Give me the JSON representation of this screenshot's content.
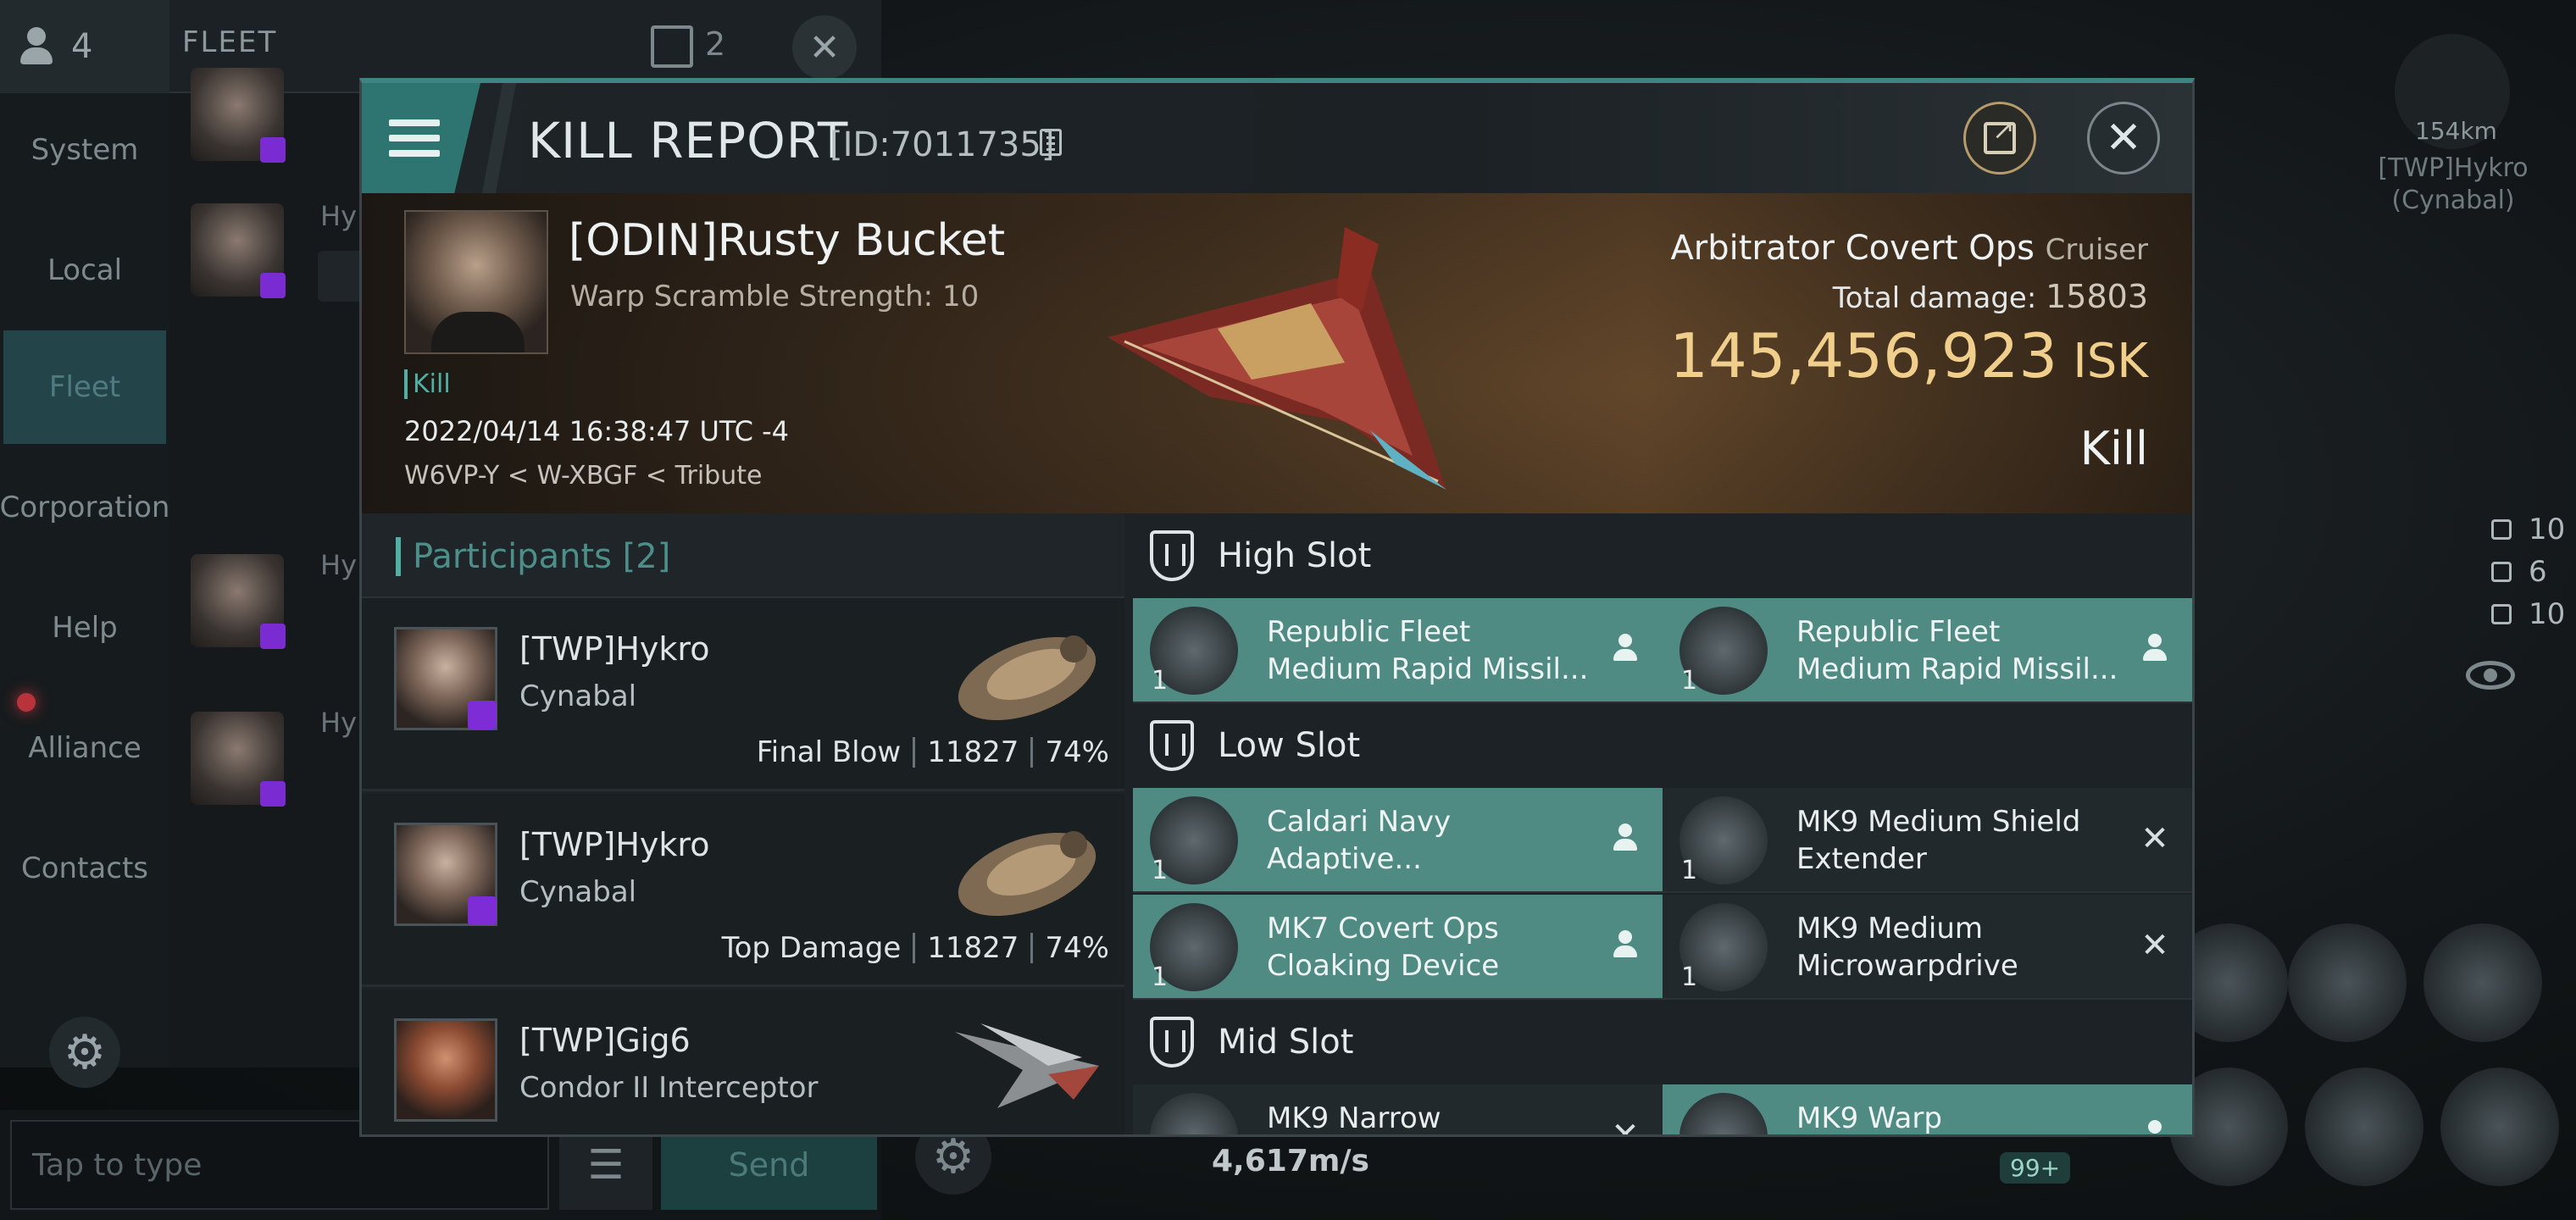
{
  "background": {
    "member_count": "4",
    "fleet_label": "FLEET",
    "fleet_window_count": "2",
    "nav": [
      "System",
      "Local",
      "Fleet",
      "Corporation",
      "Help",
      "Alliance",
      "Contacts"
    ],
    "chat_name_prefix": "Hy",
    "chat_input_placeholder": "Tap to type",
    "send_label": "Send",
    "speed": "4,617m/s",
    "target": {
      "distance": "154km",
      "name": "[TWP]Hykro (Cynabal)"
    },
    "stats": [
      "10",
      "6",
      "10"
    ],
    "cargo_badge": "99+"
  },
  "modal": {
    "title": "KILL REPORT",
    "report_id": "[ID:7011735]",
    "victim": {
      "name": "[ODIN]Rusty Bucket",
      "warp_scramble": "Warp Scramble Strength: 10",
      "kill_tag": "Kill",
      "date": "2022/04/14 16:38:47 UTC -4",
      "location": "W6VP-Y < W-XBGF < Tribute",
      "ship": "Arbitrator Covert Ops",
      "ship_class": "Cruiser",
      "total_damage_label": "Total damage:",
      "total_damage": "15803",
      "isk_value": "145,456,923",
      "isk_unit": "ISK",
      "result": "Kill"
    },
    "participants": {
      "header": "Participants [2]",
      "rows": [
        {
          "name": "[TWP]Hykro",
          "ship": "Cynabal",
          "role": "Final Blow",
          "damage": "11827",
          "percent": "74%"
        },
        {
          "name": "[TWP]Hykro",
          "ship": "Cynabal",
          "role": "Top Damage",
          "damage": "11827",
          "percent": "74%"
        },
        {
          "name": "[TWP]Gig6",
          "ship": "Condor II Interceptor"
        }
      ]
    },
    "fitting": {
      "high_slot": "High Slot",
      "low_slot": "Low Slot",
      "mid_slot": "Mid Slot",
      "modules": {
        "high_1": {
          "name": "Republic Fleet Medium Rapid Missil...",
          "qty": "1"
        },
        "high_2": {
          "name": "Republic Fleet Medium Rapid Missil...",
          "qty": "1"
        },
        "low_1": {
          "name": "Caldari Navy Adaptive...",
          "qty": "1"
        },
        "low_2": {
          "name": "MK9 Medium Shield Extender",
          "qty": "1"
        },
        "low_3": {
          "name": "MK7 Covert Ops Cloaking Device",
          "qty": "1"
        },
        "low_4": {
          "name": "MK9 Medium Microwarpdrive",
          "qty": "1"
        },
        "mid_1": {
          "name": "MK9 Narrow"
        },
        "mid_2": {
          "name": "MK9 Warp"
        }
      }
    }
  }
}
